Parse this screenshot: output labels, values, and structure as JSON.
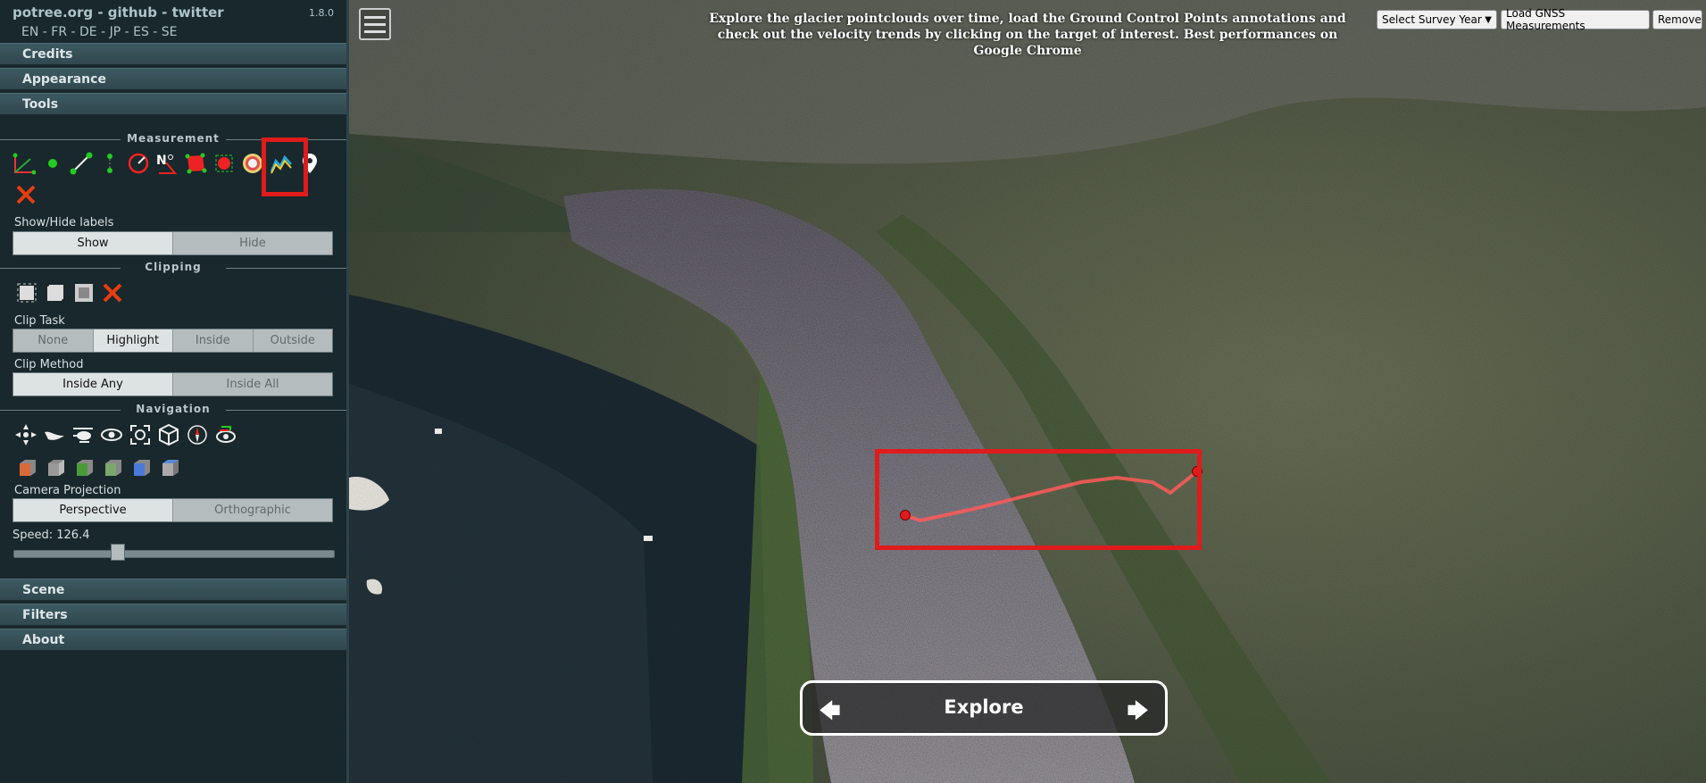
{
  "sidebar": {
    "brand": {
      "potree": "potree.org",
      "sep1": " - ",
      "github": "github",
      "sep2": " - ",
      "twitter": "twitter"
    },
    "version": "1.8.0",
    "languages": "EN - FR - DE - JP - ES - SE",
    "accordions_top": [
      "Credits",
      "Appearance",
      "Tools"
    ],
    "measurement": {
      "title": "Measurement",
      "show_hide_label": "Show/Hide labels",
      "show": "Show",
      "hide": "Hide"
    },
    "clipping": {
      "title": "Clipping",
      "clip_task_label": "Clip Task",
      "clip_task_options": [
        "None",
        "Highlight",
        "Inside",
        "Outside"
      ],
      "clip_task_selected": "Highlight",
      "clip_method_label": "Clip Method",
      "clip_method_options": [
        "Inside Any",
        "Inside All"
      ],
      "clip_method_selected": "Inside Any"
    },
    "navigation": {
      "title": "Navigation",
      "camera_projection_label": "Camera Projection",
      "projection_options": [
        "Perspective",
        "Orthographic"
      ],
      "projection_selected": "Perspective",
      "speed_label": "Speed: 126.4",
      "speed_fraction": 0.32
    },
    "accordions_bottom": [
      "Scene",
      "Filters",
      "About"
    ]
  },
  "map": {
    "banner_text": "Explore the glacier pointclouds over time, load the Ground Control Points annotations and check out the velocity trends by clicking on the target of interest. Best performances on Google Chrome",
    "survey_select": "Select Survey Year",
    "load_gnss": "Load GNSS Measurements",
    "remove": "Remove",
    "explore_label": "Explore",
    "left_arrow": "🡄",
    "right_arrow": "🡆"
  },
  "colors": {
    "highlight": "#e01b1b",
    "profile_line": "#ff5a5a"
  }
}
